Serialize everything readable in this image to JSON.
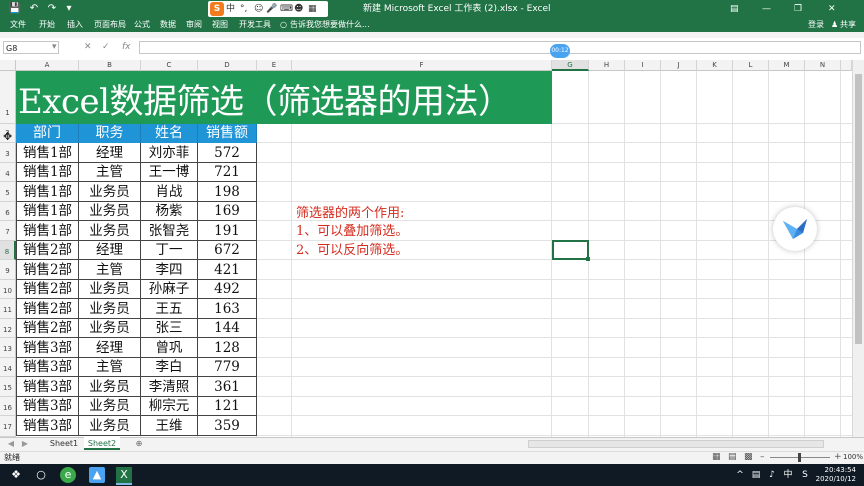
{
  "window": {
    "title": "新建 Microsoft Excel 工作表 (2).xlsx  -  Excel",
    "login": "登录",
    "share": "共享"
  },
  "ime": {
    "logo": "S",
    "label": "中"
  },
  "ribbon": {
    "tabs": [
      "文件",
      "开始",
      "插入",
      "页面布局",
      "公式",
      "数据",
      "审阅",
      "视图",
      "开发工具"
    ],
    "tell_me": "告诉我您想要做什么..."
  },
  "formula_bar": {
    "name_box": "G8",
    "fx": "fx",
    "value": ""
  },
  "timer": "00:12",
  "columns": [
    "A",
    "B",
    "C",
    "D",
    "E",
    "F",
    "G",
    "H",
    "I",
    "J",
    "K",
    "L",
    "M",
    "N"
  ],
  "rows": [
    "1",
    "2",
    "3",
    "4",
    "5",
    "6",
    "7",
    "8",
    "9",
    "10",
    "11",
    "12",
    "13",
    "14",
    "15",
    "16",
    "17"
  ],
  "sheet": {
    "title": "Excel数据筛选（筛选器的用法）",
    "headers": [
      "部门",
      "职务",
      "姓名",
      "销售额"
    ],
    "data": [
      [
        "销售1部",
        "经理",
        "刘亦菲",
        "572"
      ],
      [
        "销售1部",
        "主管",
        "王一博",
        "721"
      ],
      [
        "销售1部",
        "业务员",
        "肖战",
        "198"
      ],
      [
        "销售1部",
        "业务员",
        "杨紫",
        "169"
      ],
      [
        "销售1部",
        "业务员",
        "张智尧",
        "191"
      ],
      [
        "销售2部",
        "经理",
        "丁一",
        "672"
      ],
      [
        "销售2部",
        "主管",
        "李四",
        "421"
      ],
      [
        "销售2部",
        "业务员",
        "孙麻子",
        "492"
      ],
      [
        "销售2部",
        "业务员",
        "王五",
        "163"
      ],
      [
        "销售2部",
        "业务员",
        "张三",
        "144"
      ],
      [
        "销售3部",
        "经理",
        "曾巩",
        "128"
      ],
      [
        "销售3部",
        "主管",
        "李白",
        "779"
      ],
      [
        "销售3部",
        "业务员",
        "李清照",
        "361"
      ],
      [
        "销售3部",
        "业务员",
        "柳宗元",
        "121"
      ],
      [
        "销售3部",
        "业务员",
        "王维",
        "359"
      ]
    ],
    "notes": [
      "筛选器的两个作用:",
      "1、可以叠加筛选。",
      "2、可以反向筛选。"
    ]
  },
  "sheet_tabs": [
    "Sheet1",
    "Sheet2"
  ],
  "active_sheet": "Sheet2",
  "status": {
    "ready": "就绪",
    "zoom": "100%"
  },
  "taskbar": {
    "time": "20:43:54",
    "date": "2020/10/12"
  },
  "colors": {
    "excel_green": "#217346",
    "title_fill": "#1f9a56",
    "header_fill": "#1f94d6",
    "note_red": "#d52b1e"
  }
}
